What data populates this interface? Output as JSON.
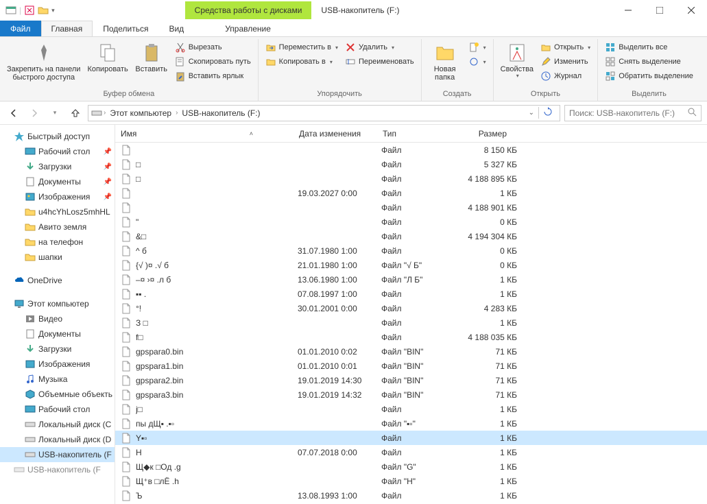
{
  "titlebar": {
    "context_tab": "Средства работы с дисками",
    "title": "USB-накопитель (F:)"
  },
  "tabs": {
    "file": "Файл",
    "home": "Главная",
    "share": "Поделиться",
    "view": "Вид",
    "manage": "Управление"
  },
  "ribbon": {
    "clipboard": {
      "pin": "Закрепить на панели\nбыстрого доступа",
      "copy": "Копировать",
      "paste": "Вставить",
      "cut": "Вырезать",
      "copy_path": "Скопировать путь",
      "paste_shortcut": "Вставить ярлык",
      "label": "Буфер обмена"
    },
    "organize": {
      "move_to": "Переместить в",
      "copy_to": "Копировать в",
      "delete": "Удалить",
      "rename": "Переименовать",
      "label": "Упорядочить"
    },
    "new": {
      "new_folder": "Новая\nпапка",
      "label": "Создать"
    },
    "open": {
      "properties": "Свойства",
      "open": "Открыть",
      "edit": "Изменить",
      "history": "Журнал",
      "label": "Открыть"
    },
    "select": {
      "select_all": "Выделить все",
      "select_none": "Снять выделение",
      "invert": "Обратить выделение",
      "label": "Выделить"
    }
  },
  "address": {
    "root": "Этот компьютер",
    "current": "USB-накопитель (F:)"
  },
  "search": {
    "placeholder": "Поиск: USB-накопитель (F:)"
  },
  "nav": {
    "quick_access": "Быстрый доступ",
    "desktop": "Рабочий стол",
    "downloads": "Загрузки",
    "documents": "Документы",
    "pictures": "Изображения",
    "folder1": "u4hcYhLosz5mhHL",
    "folder2": "Авито земля",
    "folder3": "на телефон",
    "folder4": "шапки",
    "onedrive": "OneDrive",
    "this_pc": "Этот компьютер",
    "videos": "Видео",
    "documents2": "Документы",
    "downloads2": "Загрузки",
    "pictures2": "Изображения",
    "music": "Музыка",
    "objects3d": "Объемные объекть",
    "desktop2": "Рабочий стол",
    "local_c": "Локальный диск (C",
    "local_d": "Локальный диск (D",
    "usb_f": "USB-накопитель (F",
    "usb_f2": "USB-накопитель (F"
  },
  "columns": {
    "name": "Имя",
    "date": "Дата изменения",
    "type": "Тип",
    "size": "Размер"
  },
  "files": [
    {
      "name": "",
      "date": "",
      "type": "Файл",
      "size": "8 150 КБ"
    },
    {
      "name": "□",
      "date": "",
      "type": "Файл",
      "size": "5 327 КБ"
    },
    {
      "name": "□",
      "date": "",
      "type": "Файл",
      "size": "4 188 895 КБ"
    },
    {
      "name": "",
      "date": "19.03.2027 0:00",
      "type": "Файл",
      "size": "1 КБ"
    },
    {
      "name": "",
      "date": "",
      "type": "Файл",
      "size": "4 188 901 КБ"
    },
    {
      "name": "\"",
      "date": "",
      "type": "Файл",
      "size": "0 КБ"
    },
    {
      "name": "&□",
      "date": "",
      "type": "Файл",
      "size": "4 194 304 КБ"
    },
    {
      "name": "^ б",
      "date": "31.07.1980 1:00",
      "type": "Файл",
      "size": "0 КБ"
    },
    {
      "name": "{√  )¤ .√ б",
      "date": "21.01.1980 1:00",
      "type": "Файл \"√ Б\"",
      "size": "0 КБ"
    },
    {
      "name": "–¤ ›¤ .л б",
      "date": "13.06.1980 1:00",
      "type": "Файл \"Л Б\"",
      "size": "1 КБ"
    },
    {
      "name": "▪▪   .",
      "date": "07.08.1997 1:00",
      "type": "Файл",
      "size": "1 КБ"
    },
    {
      "name": "°!",
      "date": "30.01.2001 0:00",
      "type": "Файл",
      "size": "4 283 КБ"
    },
    {
      "name": "З  □",
      "date": "",
      "type": "Файл",
      "size": "1 КБ"
    },
    {
      "name": "f□",
      "date": "",
      "type": "Файл",
      "size": "4 188 035 КБ"
    },
    {
      "name": "gpspara0.bin",
      "date": "01.01.2010 0:02",
      "type": "Файл \"BIN\"",
      "size": "71 КБ"
    },
    {
      "name": "gpspara1.bin",
      "date": "01.01.2010 0:01",
      "type": "Файл \"BIN\"",
      "size": "71 КБ"
    },
    {
      "name": "gpspara2.bin",
      "date": "19.01.2019 14:30",
      "type": "Файл \"BIN\"",
      "size": "71 КБ"
    },
    {
      "name": "gpspara3.bin",
      "date": "19.01.2019 14:32",
      "type": "Файл \"BIN\"",
      "size": "71 КБ"
    },
    {
      "name": "j□",
      "date": "",
      "type": "Файл",
      "size": "1 КБ"
    },
    {
      "name": "пы  дЩ▪ .▪▫",
      "date": "",
      "type": "Файл \"▪▫\"",
      "size": "1 КБ"
    },
    {
      "name": "Y▪▫",
      "date": "",
      "type": "Файл",
      "size": "1 КБ",
      "selected": true
    },
    {
      "name": "Н",
      "date": "07.07.2018 0:00",
      "type": "Файл",
      "size": "1 КБ"
    },
    {
      "name": "Щ◆к □Од .g",
      "date": "",
      "type": "Файл \"G\"",
      "size": "1 КБ"
    },
    {
      "name": "Щ⁺в □лЁ .h",
      "date": "",
      "type": "Файл \"H\"",
      "size": "1 КБ"
    },
    {
      "name": "Ъ",
      "date": "13.08.1993 1:00",
      "type": "Файл",
      "size": "1 КБ"
    }
  ]
}
